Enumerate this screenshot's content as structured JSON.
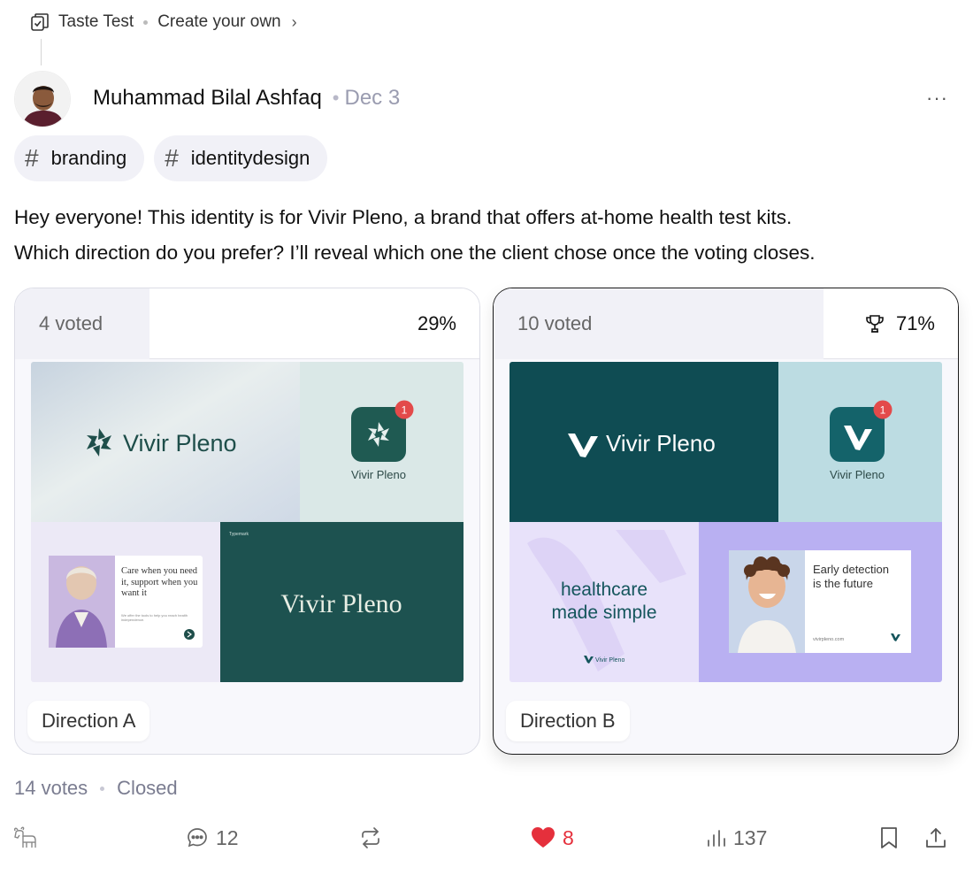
{
  "breadcrumb": {
    "section": "Taste Test",
    "link": "Create your own"
  },
  "post": {
    "author": "Muhammad Bilal Ashfaq",
    "date": "Dec 3",
    "tags": [
      "branding",
      "identitydesign"
    ],
    "text_line1": "Hey everyone! This identity is for Vivir Pleno, a brand that offers at-home health test kits.",
    "text_line2": "Which direction do you prefer? I’ll reveal which one the client chose once the voting closes."
  },
  "poll": {
    "options": [
      {
        "label": "Direction A",
        "votes": "4 voted",
        "percent": "29%",
        "share": 0.29,
        "winner": false,
        "image": {
          "logo": "Vivir Pleno",
          "app_name": "Vivir Pleno",
          "badge": "1",
          "card_title": "Care when you need it, support when you want it",
          "card_small": "We offer the tools to help you reach health independence.",
          "corner_label": "Typemark",
          "wordmark": "Vivir Pleno"
        }
      },
      {
        "label": "Direction B",
        "votes": "10 voted",
        "percent": "71%",
        "share": 0.71,
        "winner": true,
        "image": {
          "logo": "Vivir Pleno",
          "app_name": "Vivir Pleno",
          "badge": "1",
          "tagline_line1": "healthcare",
          "tagline_line2": "made simple",
          "small_brand": "Vivir Pleno",
          "card_line1": "Early detection",
          "card_line2": "is the future",
          "url": "vivirpleno.com"
        }
      }
    ],
    "summary": {
      "total": "14 votes",
      "status": "Closed"
    }
  },
  "actions": {
    "comments": "12",
    "likes": "8",
    "views": "137"
  },
  "colors": {
    "accent_red": "#e5303c",
    "teal_dark": "#0f4c53",
    "green_dark": "#1d5250",
    "lavender": "#b9b0f2"
  },
  "icons": [
    "taste-test-icon",
    "chevron-right-icon",
    "more-icon",
    "hash-icon",
    "trophy-icon",
    "goat-icon",
    "comment-icon",
    "repost-icon",
    "heart-icon",
    "views-icon",
    "bookmark-icon",
    "share-icon"
  ]
}
